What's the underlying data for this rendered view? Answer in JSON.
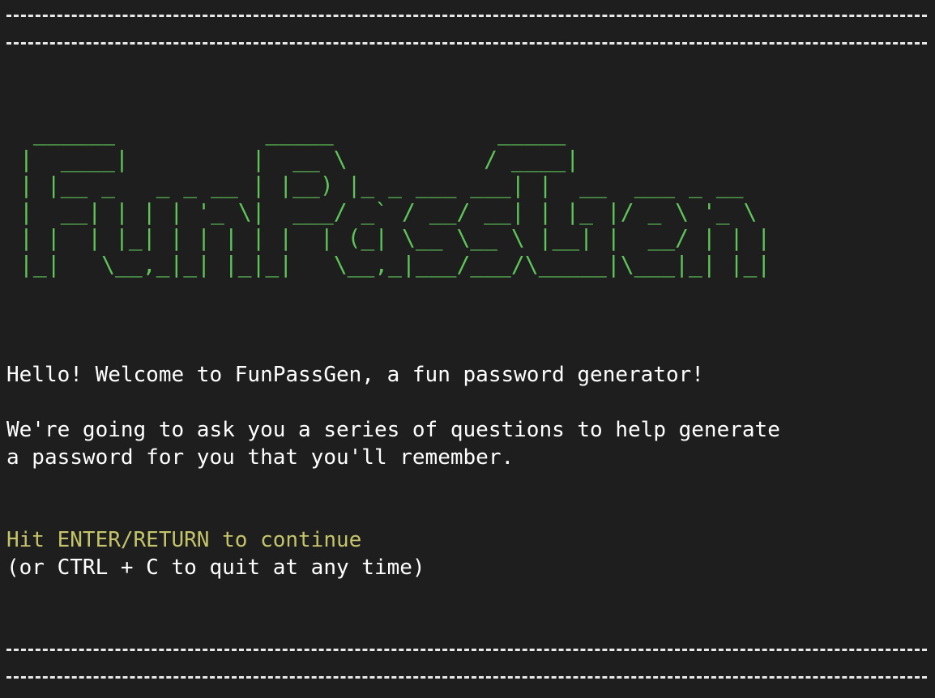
{
  "colors": {
    "background": "#1e1e1e",
    "text": "#ffffff",
    "banner": "#5fc45a",
    "prompt": "#c4c46a",
    "rule": "#e8e8e8"
  },
  "banner_ascii": " ______           _____            _____\n|  ____|         |  __ \\          / ____|\n| |__ _   _ _ __ | |__) |_ _ ___ ___| |  __  ___ _ __\n|  __| | | | '_ \\|  ___/ _` / __/ __| | |_ |/ _ \\ '_ \\\n| |  | |_| | | | | |  | (_| \\__ \\__ \\ |__| |  __/ | | |\n|_|   \\__,_|_| |_|_|   \\__,_|___/___/\\_____|\\___|_| |_|",
  "welcome_line": "Hello! Welcome to FunPassGen, a fun password generator!",
  "intro_line_1": "We're going to ask you a series of questions to help generate",
  "intro_line_2": "a password for you that you'll remember.",
  "continue_prompt": "Hit ENTER/RETURN to continue",
  "quit_hint": "(or CTRL + C to quit at any time)"
}
